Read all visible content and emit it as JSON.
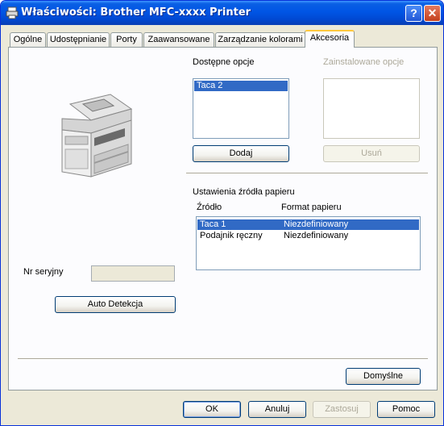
{
  "window": {
    "title": "Właściwości: Brother MFC-xxxx Printer",
    "help_glyph": "?",
    "close_glyph": "✕"
  },
  "tabs": [
    {
      "label": "Ogólne"
    },
    {
      "label": "Udostępnianie"
    },
    {
      "label": "Porty"
    },
    {
      "label": "Zaawansowane"
    },
    {
      "label": "Zarządzanie kolorami"
    },
    {
      "label": "Akcesoria"
    }
  ],
  "accessories": {
    "available_label": "Dostępne opcje",
    "installed_label": "Zainstalowane opcje",
    "available_items": [
      "Taca 2"
    ],
    "add_button": "Dodaj",
    "remove_button": "Usuń"
  },
  "paper_source": {
    "section_label": "Ustawienia źródła papieru",
    "col_source": "Źródło",
    "col_format": "Format papieru",
    "rows": [
      {
        "source": "Taca 1",
        "format": "Niezdefiniowany"
      },
      {
        "source": "Podajnik ręczny",
        "format": "Niezdefiniowany"
      }
    ]
  },
  "serial": {
    "label": "Nr seryjny",
    "value": ""
  },
  "auto_detect_button": "Auto Detekcja",
  "defaults_button": "Domyślne",
  "footer": {
    "ok": "OK",
    "cancel": "Anuluj",
    "apply": "Zastosuj",
    "help": "Pomoc"
  }
}
